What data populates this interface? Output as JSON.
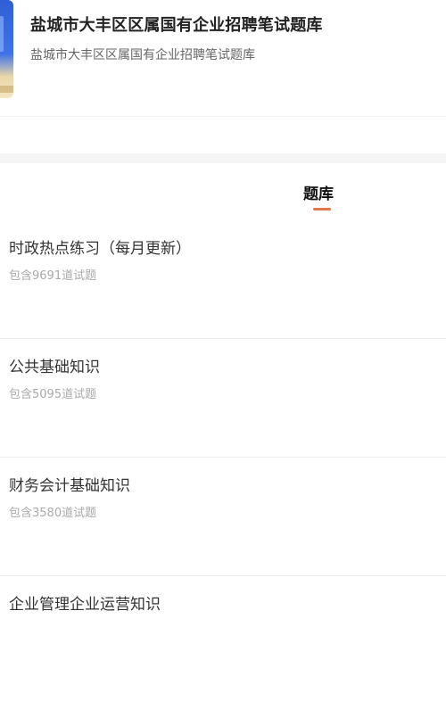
{
  "header": {
    "title": "盐城市大丰区区属国有企业招聘笔试题库",
    "subtitle": "盐城市大丰区区属国有企业招聘笔试题库"
  },
  "tabs": [
    {
      "label": "题库",
      "active": true
    }
  ],
  "accent_color": "#e4744a",
  "question_banks": [
    {
      "name": "时政热点练习（每月更新）",
      "count_text": "包含9691道试题"
    },
    {
      "name": "公共基础知识",
      "count_text": "包含5095道试题"
    },
    {
      "name": "财务会计基础知识",
      "count_text": "包含3580道试题"
    },
    {
      "name": "企业管理企业运营知识",
      "count_text": ""
    }
  ]
}
